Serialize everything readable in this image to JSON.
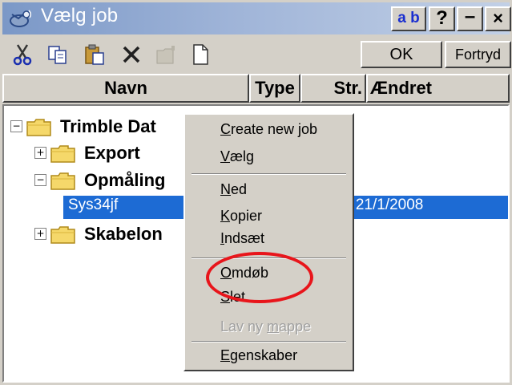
{
  "window": {
    "title": "Vælg job",
    "title_icon": "satellite-icon",
    "buttons": {
      "ab_a": "a",
      "ab_b": "b",
      "help": "?",
      "minimize": "–",
      "close": "×"
    }
  },
  "toolbar": {
    "icons": [
      "cut-icon",
      "copy-icon",
      "paste-icon",
      "delete-icon",
      "new-folder-icon",
      "new-file-icon"
    ],
    "ok_label": "OK",
    "cancel_label": "Fortryd"
  },
  "columns": {
    "name": "Navn",
    "type": "Type",
    "size": "Str.",
    "modified": "Ændret"
  },
  "tree": {
    "items": [
      {
        "label": "Trimble Dat",
        "expander": "−"
      },
      {
        "label": "Export",
        "expander": "+"
      },
      {
        "label": "Opmåling",
        "expander": "−"
      },
      {
        "label": "Skabelon",
        "expander": "+"
      }
    ],
    "selected": {
      "name": "Sys34jf",
      "modified": "b 21/1/2008"
    }
  },
  "context_menu": {
    "items": [
      {
        "prefix": "",
        "key": "C",
        "rest": "reate new job",
        "enabled": true
      },
      {
        "prefix": "",
        "key": "V",
        "rest": "ælg",
        "enabled": true
      },
      {
        "prefix": "",
        "key": "N",
        "rest": "ed",
        "enabled": true
      },
      {
        "prefix": "",
        "key": "K",
        "rest": "opier",
        "enabled": true
      },
      {
        "prefix": "",
        "key": "I",
        "rest": "ndsæt",
        "enabled": true
      },
      {
        "prefix": "",
        "key": "O",
        "rest": "mdøb",
        "enabled": true
      },
      {
        "prefix": "",
        "key": "S",
        "rest": "let",
        "enabled": true
      },
      {
        "prefix": "Lav ny ",
        "key": "m",
        "rest": "appe",
        "enabled": false
      },
      {
        "prefix": "",
        "key": "E",
        "rest": "genskaber",
        "enabled": true
      }
    ]
  },
  "colors": {
    "selection": "#1d6bd4",
    "annotation": "#e8151b",
    "titlebar_start": "#7b98c7",
    "titlebar_end": "#c2d0e6"
  }
}
